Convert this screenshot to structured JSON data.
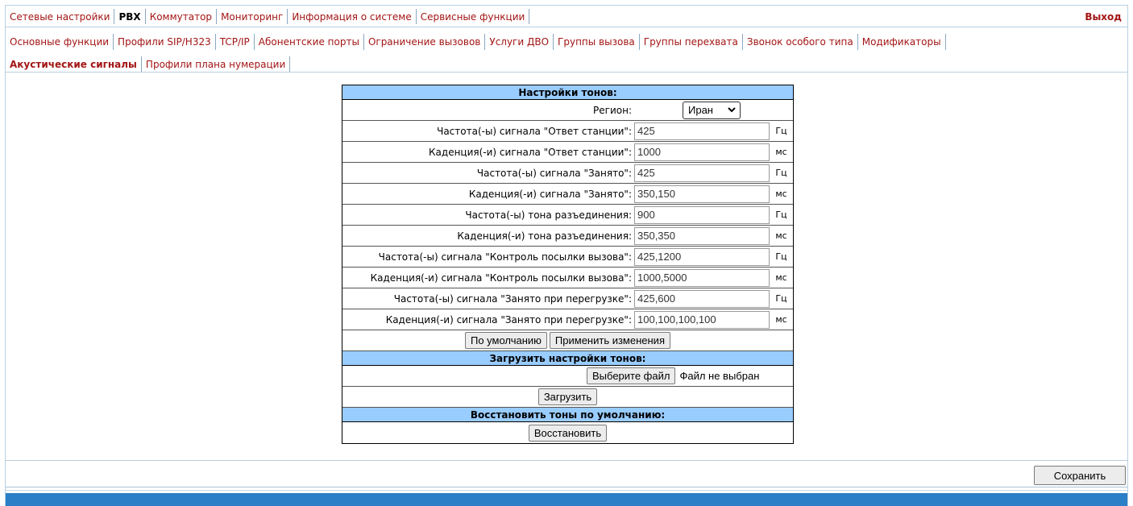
{
  "top_menu": [
    {
      "label": "Сетевые настройки",
      "active": false
    },
    {
      "label": "PBX",
      "active": true
    },
    {
      "label": "Коммутатор",
      "active": false
    },
    {
      "label": "Мониторинг",
      "active": false
    },
    {
      "label": "Информация о системе",
      "active": false
    },
    {
      "label": "Сервисные функции",
      "active": false
    }
  ],
  "exit_label": "Выход",
  "sub_menu": [
    "Основные функции",
    "Профили SIP/H323",
    "TCP/IP",
    "Абонентские порты",
    "Ограничение вызовов",
    "Услуги ДВО",
    "Группы вызова",
    "Группы перехвата",
    "Звонок особого типа",
    "Модификаторы"
  ],
  "sub_menu2": [
    {
      "label": "Акустические сигналы",
      "active": true
    },
    {
      "label": "Профили плана нумерации",
      "active": false
    }
  ],
  "tone_settings": {
    "header": "Настройки тонов:",
    "region_label": "Регион:",
    "region_value": "Иран",
    "rows": [
      {
        "label": "Частота(-ы) сигнала \"Ответ станции\":",
        "value": "425",
        "unit": "Гц"
      },
      {
        "label": "Каденция(-и) сигнала \"Ответ станции\":",
        "value": "1000",
        "unit": "мс"
      },
      {
        "label": "Частота(-ы) сигнала \"Занято\":",
        "value": "425",
        "unit": "Гц"
      },
      {
        "label": "Каденция(-и) сигнала \"Занято\":",
        "value": "350,150",
        "unit": "мс"
      },
      {
        "label": "Частота(-ы) тона разъединения:",
        "value": "900",
        "unit": "Гц"
      },
      {
        "label": "Каденция(-и) тона разъединения:",
        "value": "350,350",
        "unit": "мс"
      },
      {
        "label": "Частота(-ы) сигнала \"Контроль посылки вызова\":",
        "value": "425,1200",
        "unit": "Гц"
      },
      {
        "label": "Каденция(-и) сигнала \"Контроль посылки вызова\":",
        "value": "1000,5000",
        "unit": "мс"
      },
      {
        "label": "Частота(-ы) сигнала \"Занято при перегрузке\":",
        "value": "425,600",
        "unit": "Гц"
      },
      {
        "label": "Каденция(-и) сигнала \"Занято при перегрузке\":",
        "value": "100,100,100,100",
        "unit": "мс"
      }
    ],
    "default_button": "По умолчанию",
    "apply_button": "Применить изменения"
  },
  "upload": {
    "header": "Загрузить настройки тонов:",
    "choose_file_button": "Выберите файл",
    "no_file_label": "Файл не выбран",
    "upload_button": "Загрузить"
  },
  "restore": {
    "header": "Восстановить тоны по умолчанию:",
    "restore_button": "Восстановить"
  },
  "save_button": "Сохранить",
  "colors": {
    "accent_red": "#a31515",
    "header_blue": "#99ccff",
    "footer_blue": "#2a7fc6"
  }
}
